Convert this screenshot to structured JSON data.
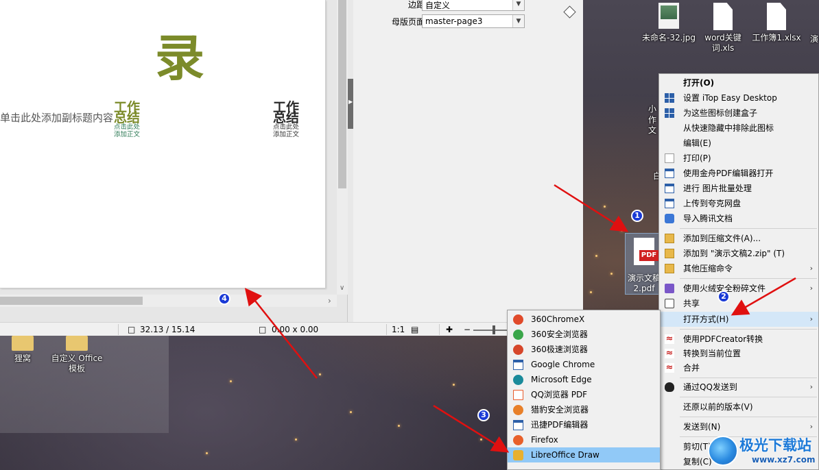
{
  "slide": {
    "big_char": "录",
    "subtitle": "单击此处添加副标题内容",
    "logo_green": {
      "line1": "工作",
      "line2": "总结",
      "line3": "点击此处",
      "line4": "添加正文"
    },
    "logo_dark": {
      "line1": "工作",
      "line2": "总结",
      "line3": "点击此处",
      "line4": "添加正文"
    }
  },
  "props": {
    "margin_label": "边距:",
    "margin_value": "自定义",
    "master_label": "母版页面:",
    "master_value": "master-page3"
  },
  "statusbar": {
    "position": "32.13 / 15.14",
    "size": "0.00 x 0.00",
    "scale": "1:1"
  },
  "desktop": {
    "icons": [
      {
        "name": "未命名-32.jpg"
      },
      {
        "name": "word关键词.xls"
      },
      {
        "name": "工作簿1.xlsx"
      },
      {
        "name": "狸窝"
      },
      {
        "name": "自定义 Office 模板"
      }
    ],
    "partial_labels": [
      "演",
      "小",
      "作文",
      "白"
    ],
    "selected_file": {
      "badge": "PDF",
      "name": "演示文稿2.pdf"
    }
  },
  "context_menu": {
    "items": [
      {
        "label": "打开(O)",
        "icon": "none",
        "bold": true
      },
      {
        "label": "设置 iTop Easy Desktop",
        "icon": "itop-grid-icon"
      },
      {
        "label": "为这些图标创建盒子",
        "icon": "itop-grid-icon"
      },
      {
        "label": "从快速隐藏中排除此图标",
        "icon": "none"
      },
      {
        "label": "编辑(E)",
        "icon": "none"
      },
      {
        "label": "打印(P)",
        "icon": "document-icon"
      },
      {
        "label": "使用金舟PDF编辑器打开",
        "icon": "app-window-icon"
      },
      {
        "label": "进行 图片批量处理",
        "icon": "app-window-icon"
      },
      {
        "label": "上传到夸克网盘",
        "icon": "app-window-icon"
      },
      {
        "label": "导入腾讯文档",
        "icon": "tencent-docs-icon"
      },
      {
        "label": "添加到压缩文件(A)...",
        "icon": "archive-icon"
      },
      {
        "label": "添加到 \"演示文稿2.zip\" (T)",
        "icon": "archive-icon"
      },
      {
        "label": "其他压缩命令",
        "icon": "archive-icon",
        "submenu": true
      },
      {
        "label": "使用火绒安全粉碎文件",
        "icon": "shredder-icon",
        "submenu": true
      },
      {
        "label": "共享",
        "icon": "share-icon"
      },
      {
        "label": "打开方式(H)",
        "icon": "none",
        "submenu": true,
        "highlight": true
      },
      {
        "label": "使用PDFCreator转换",
        "icon": "acrobat-icon"
      },
      {
        "label": "转换到当前位置",
        "icon": "acrobat-icon"
      },
      {
        "label": "合并",
        "icon": "acrobat-icon"
      },
      {
        "label": "通过QQ发送到",
        "icon": "qq-icon",
        "submenu": true
      },
      {
        "label": "还原以前的版本(V)",
        "icon": "none"
      },
      {
        "label": "发送到(N)",
        "icon": "none",
        "submenu": true
      },
      {
        "label": "剪切(T)",
        "icon": "none"
      },
      {
        "label": "复制(C)",
        "icon": "none"
      }
    ]
  },
  "open_with": {
    "items": [
      {
        "label": "360ChromeX",
        "color": "#e04a2a"
      },
      {
        "label": "360安全浏览器",
        "color": "#3aa64a"
      },
      {
        "label": "360极速浏览器",
        "color": "#d6462a"
      },
      {
        "label": "Google Chrome",
        "color": "#2c5fa8"
      },
      {
        "label": "Microsoft Edge",
        "color": "#1a8a9a"
      },
      {
        "label": "QQ浏览器 PDF",
        "color": "#e85a2a"
      },
      {
        "label": "猎豹安全浏览器",
        "color": "#e8802a"
      },
      {
        "label": "迅捷PDF编辑器",
        "color": "#2c5fa8"
      },
      {
        "label": "Firefox",
        "color": "#e8602a"
      },
      {
        "label": "LibreOffice Draw",
        "color": "#e8b030",
        "highlight": true
      }
    ]
  },
  "annotations": [
    "1",
    "2",
    "3",
    "4"
  ],
  "watermark": {
    "text": "极光下载站",
    "url": "www.xz7.com"
  }
}
